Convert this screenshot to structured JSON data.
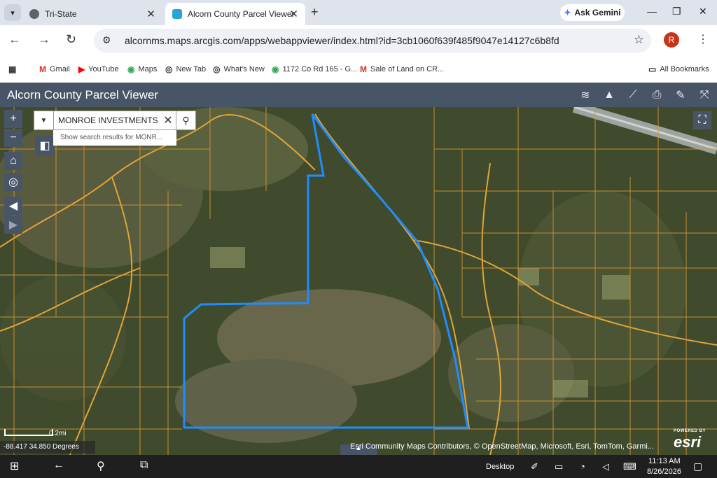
{
  "browser": {
    "tabs": [
      {
        "title": "Tri-State",
        "active": false
      },
      {
        "title": "Alcorn County Parcel Viewer",
        "active": true
      }
    ],
    "ask_gemini": "Ask Gemini",
    "url": "alcornms.maps.arcgis.com/apps/webappviewer/index.html?id=3cb1060f639f485f9047e14127c6b8fd",
    "profile_initial": "R"
  },
  "bookmarks": [
    {
      "label": "Gmail",
      "icon": "gmail-icon"
    },
    {
      "label": "YouTube",
      "icon": "youtube-icon"
    },
    {
      "label": "Maps",
      "icon": "maps-icon"
    },
    {
      "label": "New Tab",
      "icon": "chrome-icon"
    },
    {
      "label": "What's New",
      "icon": "chrome-icon"
    },
    {
      "label": "1172 Co Rd 165 - G...",
      "icon": "maps-pin-icon"
    },
    {
      "label": "Sale of Land on CR...",
      "icon": "gmail-icon"
    }
  ],
  "all_bookmarks": "All Bookmarks",
  "app": {
    "title": "Alcorn County Parcel Viewer",
    "header_tools": [
      "layers-icon",
      "graduation-cap-icon",
      "ruler-icon",
      "print-icon",
      "identify-icon",
      "share-icon"
    ],
    "colors": {
      "header": "#485566",
      "parcel_lines": "#e0a43a",
      "selected_parcel": "#1f8cff"
    }
  },
  "map": {
    "search_value": "MONROE INVESTMENTS",
    "search_suggestion": "Show search results for MONR...",
    "scale_label": "0.2mi",
    "coordinates": "-88.417 34.850 Degrees",
    "attribution": "Esri Community Maps Contributors, © OpenStreetMap, Microsoft, Esri, TomTom, Garmi...",
    "powered_by": "POWERED BY",
    "esri_logo": "esri"
  },
  "taskbar": {
    "desktop_label": "Desktop",
    "time": "11:13 AM",
    "date": "8/26/2026"
  }
}
